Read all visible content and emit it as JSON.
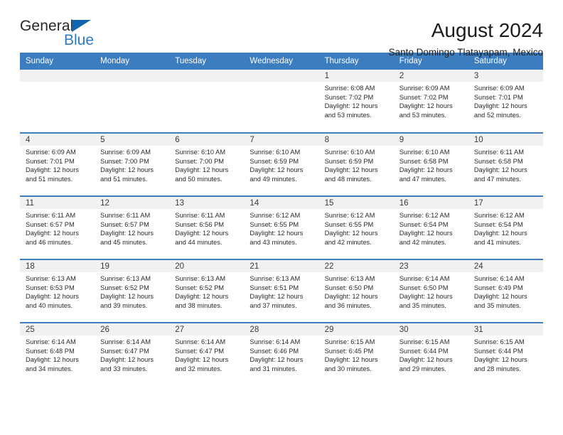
{
  "logo": {
    "word_one": "General",
    "word_two": "Blue",
    "triangle_icon": "triangle-icon"
  },
  "header": {
    "title": "August 2024",
    "subtitle": "Santo Domingo Tlatayapam, Mexico"
  },
  "weekdays": [
    "Sunday",
    "Monday",
    "Tuesday",
    "Wednesday",
    "Thursday",
    "Friday",
    "Saturday"
  ],
  "labels": {
    "sunrise": "Sunrise:",
    "sunset": "Sunset:",
    "daylight": "Daylight:"
  },
  "colors": {
    "header_blue": "#3b7dbf",
    "row_divider_blue": "#3f7fbf",
    "daynum_band": "#f1f1f1",
    "logo_blue": "#2b7cc4",
    "logo_triangle": "#1164ae"
  },
  "weeks": [
    [
      {
        "day": "",
        "lines": []
      },
      {
        "day": "",
        "lines": []
      },
      {
        "day": "",
        "lines": []
      },
      {
        "day": "",
        "lines": []
      },
      {
        "day": "1",
        "lines": [
          "Sunrise: 6:08 AM",
          "Sunset: 7:02 PM",
          "Daylight: 12 hours",
          "and 53 minutes."
        ]
      },
      {
        "day": "2",
        "lines": [
          "Sunrise: 6:09 AM",
          "Sunset: 7:02 PM",
          "Daylight: 12 hours",
          "and 53 minutes."
        ]
      },
      {
        "day": "3",
        "lines": [
          "Sunrise: 6:09 AM",
          "Sunset: 7:01 PM",
          "Daylight: 12 hours",
          "and 52 minutes."
        ]
      }
    ],
    [
      {
        "day": "4",
        "lines": [
          "Sunrise: 6:09 AM",
          "Sunset: 7:01 PM",
          "Daylight: 12 hours",
          "and 51 minutes."
        ]
      },
      {
        "day": "5",
        "lines": [
          "Sunrise: 6:09 AM",
          "Sunset: 7:00 PM",
          "Daylight: 12 hours",
          "and 51 minutes."
        ]
      },
      {
        "day": "6",
        "lines": [
          "Sunrise: 6:10 AM",
          "Sunset: 7:00 PM",
          "Daylight: 12 hours",
          "and 50 minutes."
        ]
      },
      {
        "day": "7",
        "lines": [
          "Sunrise: 6:10 AM",
          "Sunset: 6:59 PM",
          "Daylight: 12 hours",
          "and 49 minutes."
        ]
      },
      {
        "day": "8",
        "lines": [
          "Sunrise: 6:10 AM",
          "Sunset: 6:59 PM",
          "Daylight: 12 hours",
          "and 48 minutes."
        ]
      },
      {
        "day": "9",
        "lines": [
          "Sunrise: 6:10 AM",
          "Sunset: 6:58 PM",
          "Daylight: 12 hours",
          "and 47 minutes."
        ]
      },
      {
        "day": "10",
        "lines": [
          "Sunrise: 6:11 AM",
          "Sunset: 6:58 PM",
          "Daylight: 12 hours",
          "and 47 minutes."
        ]
      }
    ],
    [
      {
        "day": "11",
        "lines": [
          "Sunrise: 6:11 AM",
          "Sunset: 6:57 PM",
          "Daylight: 12 hours",
          "and 46 minutes."
        ]
      },
      {
        "day": "12",
        "lines": [
          "Sunrise: 6:11 AM",
          "Sunset: 6:57 PM",
          "Daylight: 12 hours",
          "and 45 minutes."
        ]
      },
      {
        "day": "13",
        "lines": [
          "Sunrise: 6:11 AM",
          "Sunset: 6:56 PM",
          "Daylight: 12 hours",
          "and 44 minutes."
        ]
      },
      {
        "day": "14",
        "lines": [
          "Sunrise: 6:12 AM",
          "Sunset: 6:55 PM",
          "Daylight: 12 hours",
          "and 43 minutes."
        ]
      },
      {
        "day": "15",
        "lines": [
          "Sunrise: 6:12 AM",
          "Sunset: 6:55 PM",
          "Daylight: 12 hours",
          "and 42 minutes."
        ]
      },
      {
        "day": "16",
        "lines": [
          "Sunrise: 6:12 AM",
          "Sunset: 6:54 PM",
          "Daylight: 12 hours",
          "and 42 minutes."
        ]
      },
      {
        "day": "17",
        "lines": [
          "Sunrise: 6:12 AM",
          "Sunset: 6:54 PM",
          "Daylight: 12 hours",
          "and 41 minutes."
        ]
      }
    ],
    [
      {
        "day": "18",
        "lines": [
          "Sunrise: 6:13 AM",
          "Sunset: 6:53 PM",
          "Daylight: 12 hours",
          "and 40 minutes."
        ]
      },
      {
        "day": "19",
        "lines": [
          "Sunrise: 6:13 AM",
          "Sunset: 6:52 PM",
          "Daylight: 12 hours",
          "and 39 minutes."
        ]
      },
      {
        "day": "20",
        "lines": [
          "Sunrise: 6:13 AM",
          "Sunset: 6:52 PM",
          "Daylight: 12 hours",
          "and 38 minutes."
        ]
      },
      {
        "day": "21",
        "lines": [
          "Sunrise: 6:13 AM",
          "Sunset: 6:51 PM",
          "Daylight: 12 hours",
          "and 37 minutes."
        ]
      },
      {
        "day": "22",
        "lines": [
          "Sunrise: 6:13 AM",
          "Sunset: 6:50 PM",
          "Daylight: 12 hours",
          "and 36 minutes."
        ]
      },
      {
        "day": "23",
        "lines": [
          "Sunrise: 6:14 AM",
          "Sunset: 6:50 PM",
          "Daylight: 12 hours",
          "and 35 minutes."
        ]
      },
      {
        "day": "24",
        "lines": [
          "Sunrise: 6:14 AM",
          "Sunset: 6:49 PM",
          "Daylight: 12 hours",
          "and 35 minutes."
        ]
      }
    ],
    [
      {
        "day": "25",
        "lines": [
          "Sunrise: 6:14 AM",
          "Sunset: 6:48 PM",
          "Daylight: 12 hours",
          "and 34 minutes."
        ]
      },
      {
        "day": "26",
        "lines": [
          "Sunrise: 6:14 AM",
          "Sunset: 6:47 PM",
          "Daylight: 12 hours",
          "and 33 minutes."
        ]
      },
      {
        "day": "27",
        "lines": [
          "Sunrise: 6:14 AM",
          "Sunset: 6:47 PM",
          "Daylight: 12 hours",
          "and 32 minutes."
        ]
      },
      {
        "day": "28",
        "lines": [
          "Sunrise: 6:14 AM",
          "Sunset: 6:46 PM",
          "Daylight: 12 hours",
          "and 31 minutes."
        ]
      },
      {
        "day": "29",
        "lines": [
          "Sunrise: 6:15 AM",
          "Sunset: 6:45 PM",
          "Daylight: 12 hours",
          "and 30 minutes."
        ]
      },
      {
        "day": "30",
        "lines": [
          "Sunrise: 6:15 AM",
          "Sunset: 6:44 PM",
          "Daylight: 12 hours",
          "and 29 minutes."
        ]
      },
      {
        "day": "31",
        "lines": [
          "Sunrise: 6:15 AM",
          "Sunset: 6:44 PM",
          "Daylight: 12 hours",
          "and 28 minutes."
        ]
      }
    ]
  ]
}
